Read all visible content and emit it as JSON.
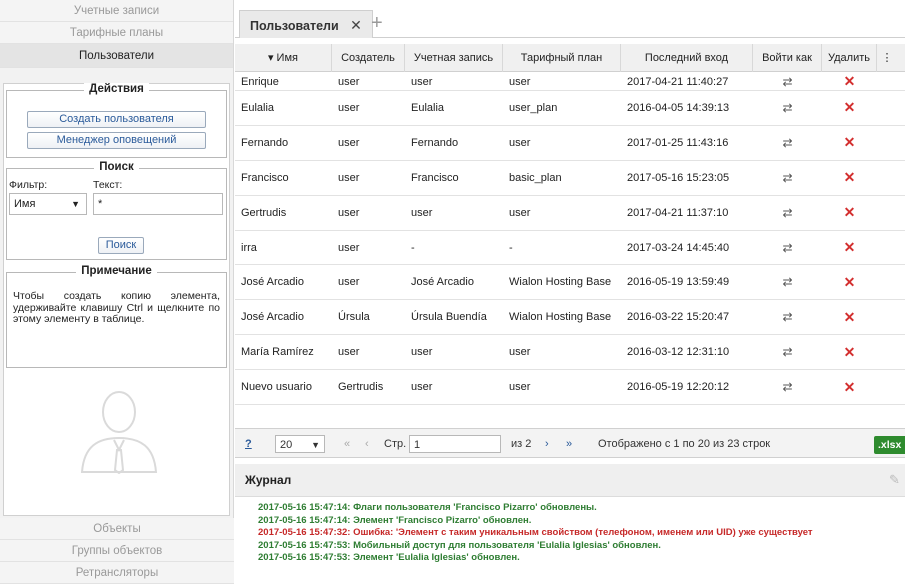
{
  "sidebar": {
    "top_items": [
      {
        "label": "Учетные записи"
      },
      {
        "label": "Тарифные планы"
      },
      {
        "label": "Пользователи"
      }
    ],
    "actions_title": "Действия",
    "create_user": "Создать пользователя",
    "notify_manager": "Менеджер оповещений",
    "search_title": "Поиск",
    "filter_label": "Фильтр:",
    "filter_value": "Имя",
    "text_label": "Текст:",
    "text_value": "*",
    "search_button": "Поиск",
    "note_title": "Примечание",
    "note_text": "Чтобы создать копию элемента, удерживайте клавишу Ctrl и щелкните по этому элементу в таблице.",
    "bottom_items": [
      {
        "label": "Объекты"
      },
      {
        "label": "Группы объектов"
      },
      {
        "label": "Ретрансляторы"
      }
    ]
  },
  "tabs": {
    "active": "Пользователи",
    "close": "✕",
    "add": "+"
  },
  "table": {
    "headers": [
      "▾ Имя",
      "Создатель",
      "Учетная запись",
      "Тарифный план",
      "Последний вход",
      "Войти как",
      "Удалить",
      "⋮"
    ],
    "rows": [
      [
        "Enrique",
        "user",
        "user",
        "user",
        "2017-04-21 11:40:27"
      ],
      [
        "Eulalia",
        "user",
        "Eulalia",
        "user_plan",
        "2016-04-05 14:39:13"
      ],
      [
        "Fernando",
        "user",
        "Fernando",
        "user",
        "2017-01-25 11:43:16"
      ],
      [
        "Francisco",
        "user",
        "Francisco",
        "basic_plan",
        "2017-05-16 15:23:05"
      ],
      [
        "Gertrudis",
        "user",
        "user",
        "user",
        "2017-04-21 11:37:10"
      ],
      [
        "irra",
        "user",
        "-",
        "-",
        "2017-03-24 14:45:40"
      ],
      [
        "José Arcadio",
        "user",
        "José Arcadio",
        "Wialon Hosting Base",
        "2016-05-19 13:59:49"
      ],
      [
        "José Arcadio",
        "Úrsula",
        "Úrsula Buendía",
        "Wialon Hosting Base",
        "2016-03-22 15:20:47"
      ],
      [
        "María Ramírez",
        "user",
        "user",
        "user",
        "2016-03-12 12:31:10"
      ],
      [
        "Nuevo usuario",
        "Gertrudis",
        "user",
        "user",
        "2016-05-19 12:20:12"
      ]
    ],
    "switch_glyph": "⇄",
    "delete_glyph": "✕"
  },
  "pager": {
    "help": "?",
    "per_page": "20",
    "first": "«",
    "prev": "‹",
    "page_label": "Стр.",
    "page_value": "1",
    "of": "из 2",
    "next": "›",
    "last": "»",
    "summary": "Отображено с 1 по 20 из 23 строк",
    "export": ".xlsx"
  },
  "log": {
    "title": "Журнал",
    "lines": [
      {
        "text": "2017-05-16 15:47:14: Флаги пользователя 'Francisco Pizarro' обновлены.",
        "type": "ok"
      },
      {
        "text": "2017-05-16 15:47:14: Элемент 'Francisco Pizarro' обновлен.",
        "type": "ok"
      },
      {
        "text": "2017-05-16 15:47:32: Ошибка: 'Элемент с таким уникальным свойством (телефоном, именем или UID) уже существует",
        "type": "err"
      },
      {
        "text": "2017-05-16 15:47:53: Мобильный доступ для пользователя 'Eulalia Iglesias' обновлен.",
        "type": "ok"
      },
      {
        "text": "2017-05-16 15:47:53: Элемент 'Eulalia Iglesias' обновлен.",
        "type": "ok"
      }
    ]
  }
}
